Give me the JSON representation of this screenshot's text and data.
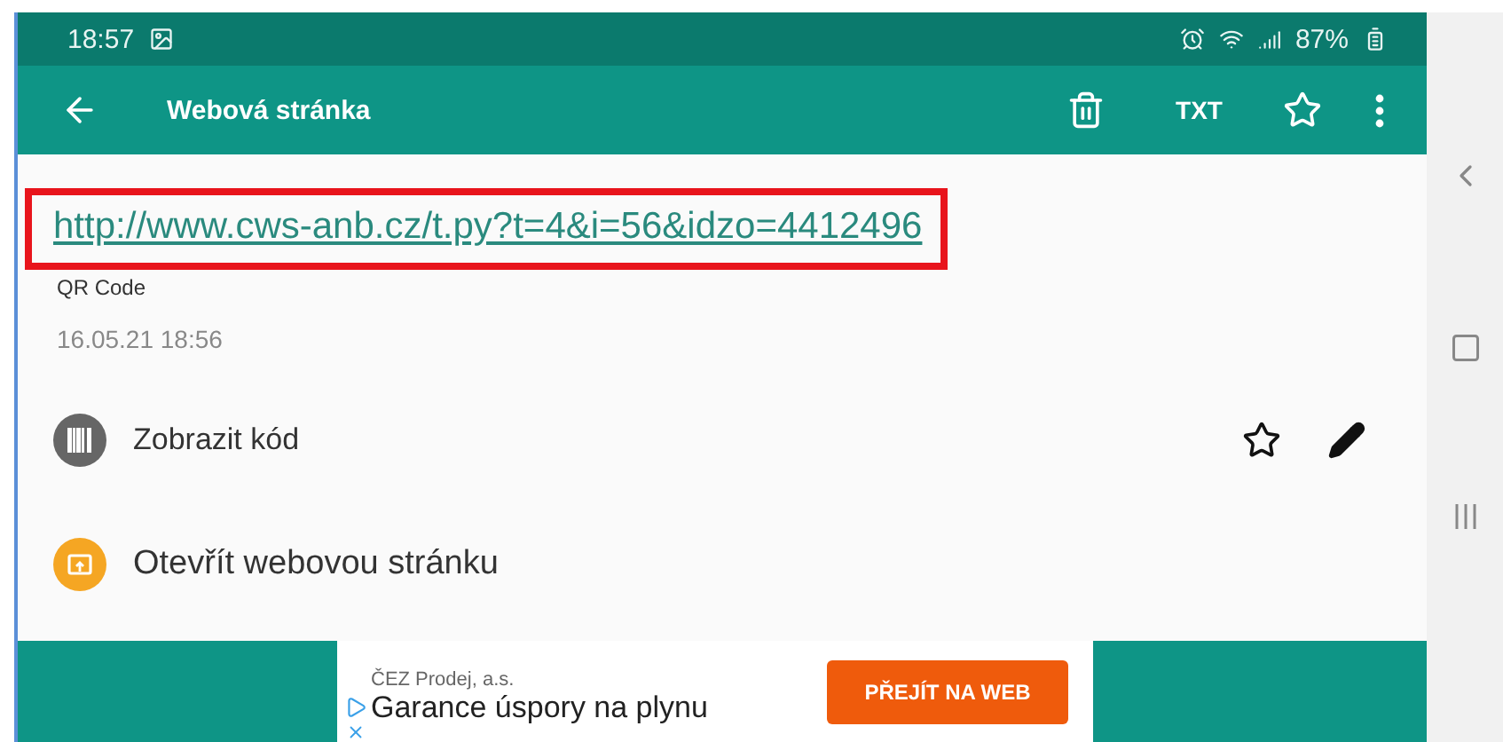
{
  "status_bar": {
    "time": "18:57",
    "battery": "87%"
  },
  "app_bar": {
    "title": "Webová stránka",
    "txt_label": "TXT"
  },
  "record": {
    "url": "http://www.cws-anb.cz/t.py?t=4&i=56&idzo=4412496",
    "format": "QR Code",
    "timestamp": "16.05.21 18:56"
  },
  "actions": [
    {
      "kind": "code",
      "label": "Zobrazit kód"
    },
    {
      "kind": "web",
      "label": "Otevřít webovou stránku"
    }
  ],
  "ad": {
    "advertiser": "ČEZ Prodej, a.s.",
    "headline": "Garance úspory na plynu",
    "button": "PŘEJÍT NA WEB"
  }
}
